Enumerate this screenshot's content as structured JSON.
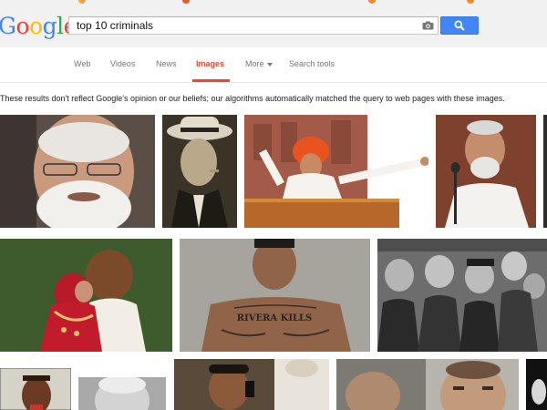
{
  "logo": {
    "text": "Google"
  },
  "search": {
    "query": "top 10 criminals"
  },
  "tabs": [
    {
      "label": "Web"
    },
    {
      "label": "Videos"
    },
    {
      "label": "News"
    },
    {
      "label": "Images"
    },
    {
      "label": "More"
    },
    {
      "label": "Search tools"
    }
  ],
  "active_tab": "Images",
  "notice": "These results don't reflect Google's opinion or our beliefs; our automatically matched the query to web pages with these images.",
  "notice_text": "These results don't reflect Google's opinion or our beliefs; our algorithms automatically matched the query to web pages with these images.",
  "results": {
    "row1": [
      "portrait-white-beard",
      "vintage-fedora-man",
      "speaker-orange-turban",
      "speaker-at-microphone"
    ],
    "row2": [
      "couple-embrace",
      "tattooed-man-mugshot",
      "black-and-white-crowd"
    ],
    "row3": [
      "mugshot-man",
      "older-man-portrait",
      "man-on-phone",
      "tiled-interior",
      "man-face-closeup",
      "dark-partial"
    ]
  },
  "tattoo_text": "RIVERA KILLS",
  "colors": {
    "accent_blue": "#4285f4",
    "active_tab_red": "#dd4b39",
    "header_bg": "#f1f1f1"
  }
}
